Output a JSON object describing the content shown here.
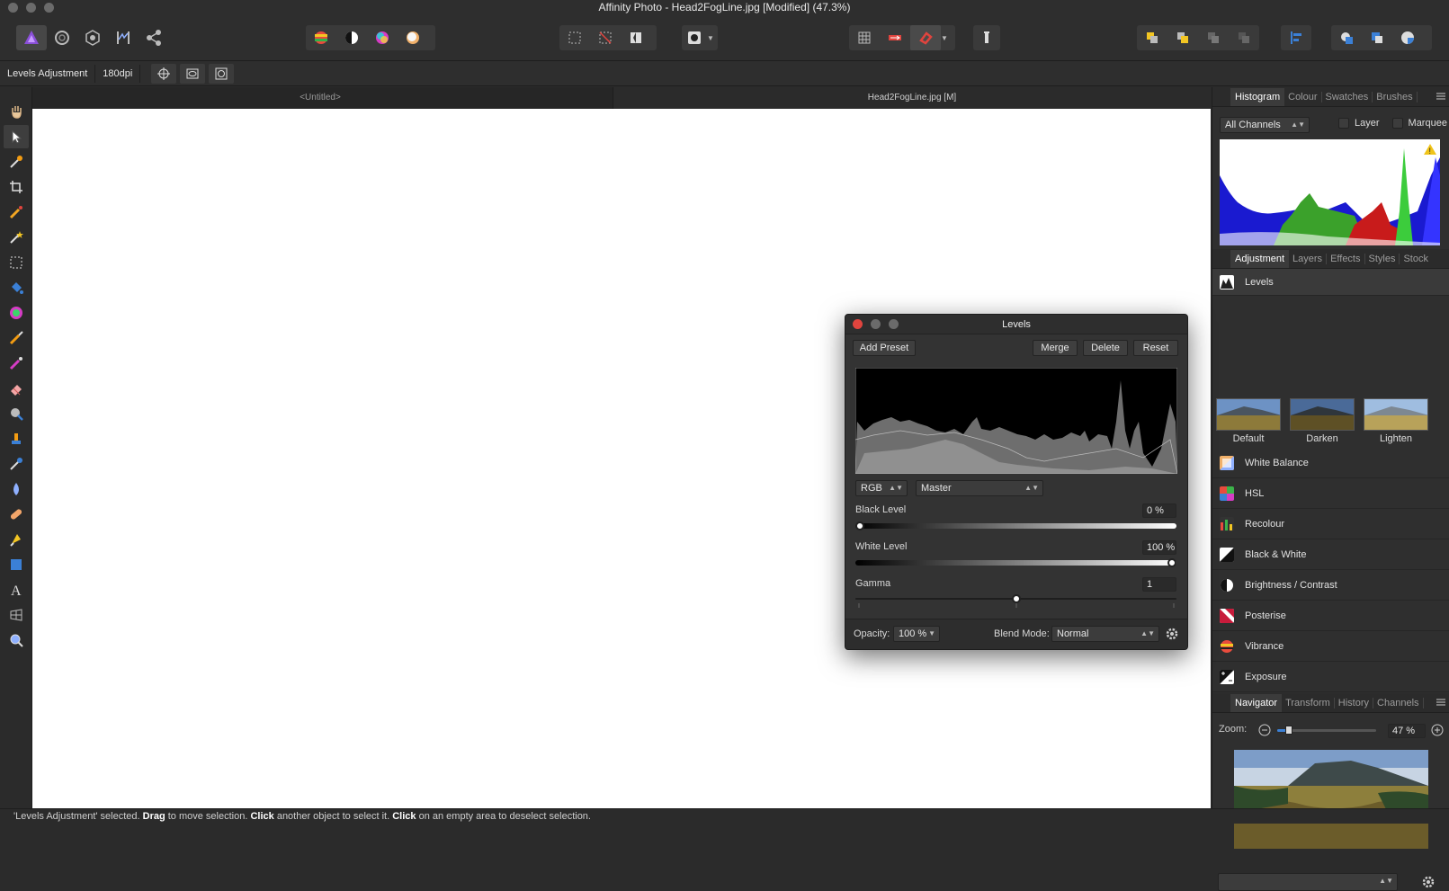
{
  "window": {
    "title": "Affinity Photo - Head2FogLine.jpg [Modified] (47.3%)"
  },
  "context_bar": {
    "tool_label": "Levels Adjustment",
    "dpi": "180dpi"
  },
  "doc_tabs": [
    {
      "label": "<Untitled>"
    },
    {
      "label": "Head2FogLine.jpg [M]"
    }
  ],
  "histogram_panel": {
    "tabs": [
      "Histogram",
      "Colour",
      "Swatches",
      "Brushes"
    ],
    "channel_select": "All Channels",
    "layer_label": "Layer",
    "marquee_label": "Marquee"
  },
  "adjustment_panel": {
    "tabs": [
      "Adjustment",
      "Layers",
      "Effects",
      "Styles",
      "Stock"
    ],
    "selected": "Levels",
    "presets": [
      "Default",
      "Darken",
      "Lighten"
    ],
    "items": [
      "White Balance",
      "HSL",
      "Recolour",
      "Black & White",
      "Brightness / Contrast",
      "Posterise",
      "Vibrance",
      "Exposure"
    ]
  },
  "navigator_panel": {
    "tabs": [
      "Navigator",
      "Transform",
      "History",
      "Channels"
    ],
    "zoom_label": "Zoom:",
    "zoom_value": "47 %",
    "zoom_fraction": 0.12
  },
  "levels_dialog": {
    "title": "Levels",
    "add_preset": "Add Preset",
    "merge": "Merge",
    "delete": "Delete",
    "reset": "Reset",
    "channel": "RGB",
    "mode": "Master",
    "black_level_label": "Black Level",
    "black_level_value": "0 %",
    "black_level_fraction": 0.0,
    "white_level_label": "White Level",
    "white_level_value": "100 %",
    "white_level_fraction": 1.0,
    "gamma_label": "Gamma",
    "gamma_value": "1",
    "gamma_fraction": 0.5,
    "opacity_label": "Opacity:",
    "opacity_value": "100 %",
    "blend_label": "Blend Mode:",
    "blend_value": "Normal"
  },
  "status_bar": {
    "part1": "'Levels Adjustment' selected. ",
    "drag": "Drag",
    "part2": " to move selection. ",
    "click1": "Click",
    "part3": " another object to select it. ",
    "click2": "Click",
    "part4": " on an empty area to deselect selection."
  },
  "colors": {
    "accent": "#3b80d6",
    "close": "#e0443e",
    "warning": "#f0c419"
  }
}
